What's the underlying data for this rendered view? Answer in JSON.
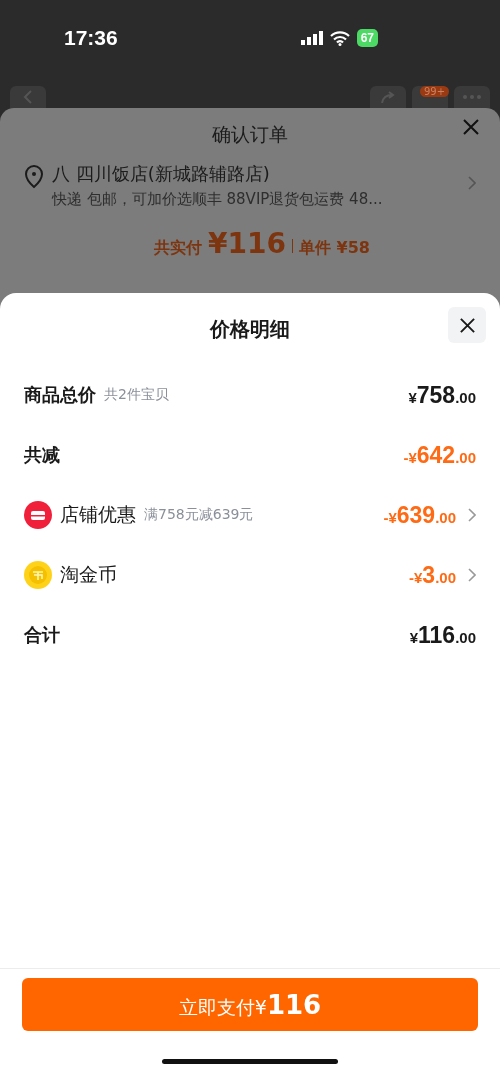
{
  "status_bar": {
    "time": "17:36",
    "battery": "67"
  },
  "background_page": {
    "nav": {
      "cart_badge": "99+"
    },
    "order_sheet": {
      "title": "确认订单",
      "address": {
        "name": "八 四川饭店(新城路辅路店)",
        "delivery": "快递 包邮，可加价选顺丰 88VIP退货包运费 48..."
      },
      "price": {
        "label": "共实付",
        "total": "¥116",
        "unit": "单件 ¥58"
      }
    }
  },
  "price_detail": {
    "title": "价格明细",
    "rows": [
      {
        "kind": "summary",
        "label": "商品总价",
        "note": "共2件宝贝",
        "amount": "¥758.00",
        "highlight": false,
        "link": false
      },
      {
        "kind": "summary",
        "label": "共减",
        "amount": "-¥642.00",
        "highlight": true,
        "link": false
      },
      {
        "kind": "store",
        "label": "店铺优惠",
        "note": "满758元减639元",
        "amount": "-¥639.00",
        "highlight": true,
        "link": true
      },
      {
        "kind": "coin",
        "label": "淘金币",
        "amount": "-¥3.00",
        "highlight": true,
        "link": true
      },
      {
        "kind": "summary",
        "label": "合计",
        "amount": "¥116.00",
        "highlight": false,
        "link": false
      }
    ]
  },
  "pay_button": {
    "label": "立即支付",
    "amount": "¥116"
  }
}
